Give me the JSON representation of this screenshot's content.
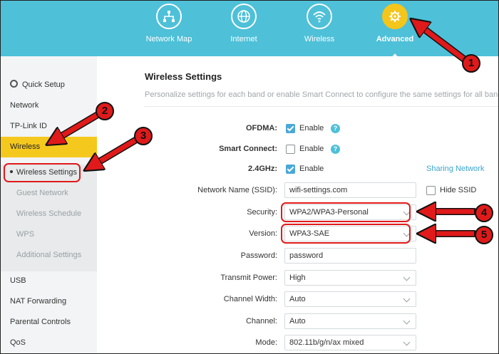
{
  "topnav": {
    "items": [
      {
        "label": "Network Map",
        "icon": "network-map-icon"
      },
      {
        "label": "Internet",
        "icon": "globe-icon"
      },
      {
        "label": "Wireless",
        "icon": "wifi-icon"
      },
      {
        "label": "Advanced",
        "icon": "gear-icon",
        "active": true
      }
    ]
  },
  "sidebar": {
    "items": [
      {
        "label": "Quick Setup"
      },
      {
        "label": "Network"
      },
      {
        "label": "TP-Link ID"
      },
      {
        "label": "Wireless"
      },
      {
        "label": "Wireless Settings"
      },
      {
        "label": "Guest Network"
      },
      {
        "label": "Wireless Schedule"
      },
      {
        "label": "WPS"
      },
      {
        "label": "Additional Settings"
      },
      {
        "label": "USB"
      },
      {
        "label": "NAT Forwarding"
      },
      {
        "label": "Parental Controls"
      },
      {
        "label": "QoS"
      }
    ]
  },
  "main": {
    "title": "Wireless Settings",
    "description": "Personalize settings for each band or enable Smart Connect to configure the same settings for all bands.",
    "ofdma": {
      "label": "OFDMA:",
      "option": "Enable",
      "checked": true
    },
    "smart_connect": {
      "label": "Smart Connect:",
      "option": "Enable",
      "checked": false
    },
    "band": {
      "label": "2.4GHz:",
      "option": "Enable",
      "checked": true,
      "sharing_link": "Sharing Network"
    },
    "ssid": {
      "label": "Network Name (SSID):",
      "value": "wifi-settings.com",
      "hide_label": "Hide SSID"
    },
    "security": {
      "label": "Security:",
      "value": "WPA2/WPA3-Personal"
    },
    "version": {
      "label": "Version:",
      "value": "WPA3-SAE"
    },
    "password": {
      "label": "Password:",
      "value": "password"
    },
    "transmit_power": {
      "label": "Transmit Power:",
      "value": "High"
    },
    "channel_width": {
      "label": "Channel Width:",
      "value": "Auto"
    },
    "channel": {
      "label": "Channel:",
      "value": "Auto"
    },
    "mode": {
      "label": "Mode:",
      "value": "802.11b/g/n/ax mixed"
    }
  },
  "annotations": {
    "badges": [
      "1",
      "2",
      "3",
      "4",
      "5"
    ],
    "arrow_color": "#e01a1a"
  },
  "colors": {
    "nav_bg": "#4ec0d8",
    "accent_yellow": "#f5c81e",
    "checkbox_blue": "#4aa8d8",
    "link_blue": "#3aa6d0"
  }
}
